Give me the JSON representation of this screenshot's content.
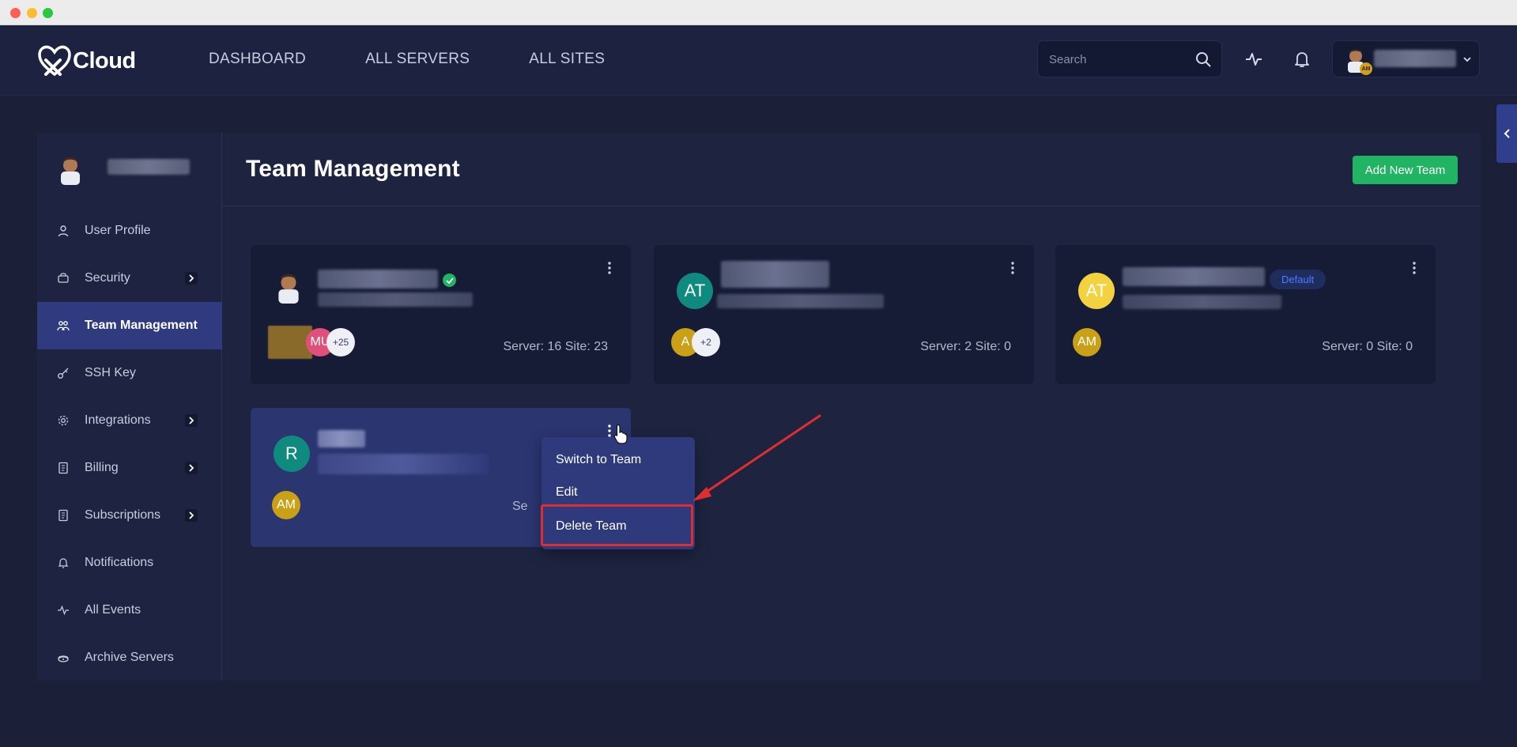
{
  "header": {
    "logo_text": "Cloud",
    "nav": [
      "DASHBOARD",
      "ALL SERVERS",
      "ALL SITES"
    ],
    "search_placeholder": "Search",
    "user_initials": "AM"
  },
  "sidebar": {
    "items": [
      {
        "label": "User Profile",
        "icon": "user-icon",
        "has_arrow": false
      },
      {
        "label": "Security",
        "icon": "security-icon",
        "has_arrow": true
      },
      {
        "label": "Team Management",
        "icon": "team-icon",
        "has_arrow": false,
        "active": true
      },
      {
        "label": "SSH Key",
        "icon": "key-icon",
        "has_arrow": false
      },
      {
        "label": "Integrations",
        "icon": "gear-icon",
        "has_arrow": true
      },
      {
        "label": "Billing",
        "icon": "billing-icon",
        "has_arrow": true
      },
      {
        "label": "Subscriptions",
        "icon": "subscriptions-icon",
        "has_arrow": true
      },
      {
        "label": "Notifications",
        "icon": "bell-icon",
        "has_arrow": false
      },
      {
        "label": "All Events",
        "icon": "activity-icon",
        "has_arrow": false
      },
      {
        "label": "Archive Servers",
        "icon": "archive-icon",
        "has_arrow": false
      }
    ]
  },
  "main": {
    "title": "Team Management",
    "add_button": "Add New Team",
    "cards": [
      {
        "avatar": "",
        "members": [
          "",
          "MU",
          "+25"
        ],
        "stats": "Server: 16   Site: 23",
        "verified": true
      },
      {
        "avatar": "AT",
        "members": [
          "A",
          "+2"
        ],
        "stats": "Server: 2   Site: 0"
      },
      {
        "avatar": "AT",
        "members": [
          "AM"
        ],
        "stats": "Server: 0   Site: 0",
        "badge": "Default"
      },
      {
        "avatar": "R",
        "members": [
          "AM"
        ],
        "stats": "Se"
      }
    ],
    "menu": [
      "Switch to Team",
      "Edit",
      "Delete Team"
    ]
  },
  "colors": {
    "accent_green": "#21b462",
    "active_nav": "#2f3b7e",
    "highlight_red": "#e02d2d",
    "teal_avatar": "#0f8a7f",
    "gold_avatar": "#c9a016",
    "yellow_avatar": "#f2d33f",
    "pink_avatar": "#e0507a"
  }
}
